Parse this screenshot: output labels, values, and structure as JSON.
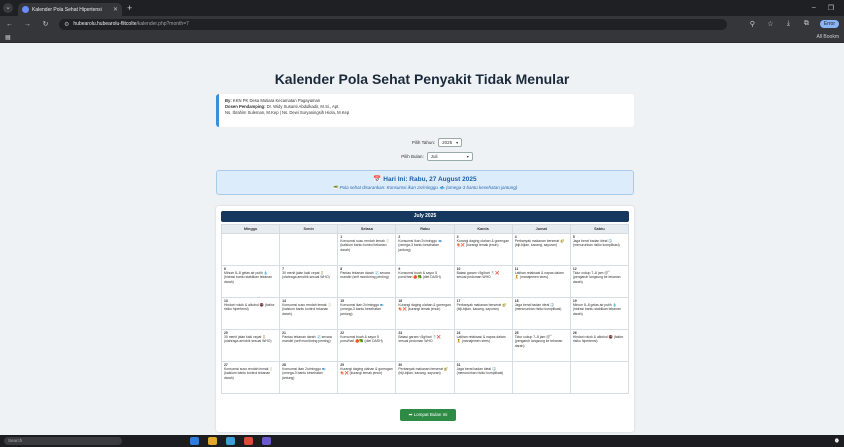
{
  "browser": {
    "tab_title": "Kalender Pola Sehat Hipertensi",
    "url_host": "hubearolu.hubearolu-flitcolte",
    "url_path": "/kalender.php?month=7",
    "all_bookmarks": "All Bookm",
    "profile_label": "Error"
  },
  "page": {
    "title": "Kalender Pola Sehat Penyakit Tidak Menular",
    "info": {
      "line1_label": "By:",
      "line1": "KKN PK Desa Mutiara Kecamatan Pagayaman",
      "line2_label": "Dosen Pendamping:",
      "line2": "Dr. Widy Susanti Abdulkadir, M.Si., Apt.",
      "line3": "Ns. Ibrahim Suleman, M.Kep | Ns. Dewi Suryaningsih Hiola, M.Kep"
    },
    "year_label": "Pilih Tahun:",
    "year_value": "2025",
    "month_label": "Pilih Bulan:",
    "month_value": "Juli",
    "today_title": "📅 Hari Ini: Rabu, 27 August 2025",
    "today_sub": "🥗 Pola sehat disarankan: Konsumsi ikan 2x/minggu 🐟 (omega-3 bantu kesehatan jantung)",
    "calendar_title": "July 2025",
    "weekdays": [
      "Minggu",
      "Senin",
      "Selasa",
      "Rabu",
      "Kamis",
      "Jumat",
      "Sabtu"
    ],
    "weeks": [
      [
        {
          "d": "",
          "t": ""
        },
        {
          "d": "",
          "t": ""
        },
        {
          "d": "1",
          "t": "Konsumsi susu rendah lemak 🥛 (kalsium bantu kontrol tekanan darah)"
        },
        {
          "d": "2",
          "t": "Konsumsi ikan 2x/minggu 🐟 (omega-3 bantu kesehatan jantung)"
        },
        {
          "d": "3",
          "t": "Kurangi daging olahan & gorengan 🍖❌ (kurangi lemak jenuh)"
        },
        {
          "d": "4",
          "t": "Perbanyak makanan berserat 🥑 (biji-bijian, kacang, sayuran)"
        },
        {
          "d": "5",
          "t": "Jaga berat badan ideal ⚖️ (menurunkan risiko komplikasi)"
        }
      ],
      [
        {
          "d": "6",
          "t": "Minum 8–8 gelas air putih 💧 (hidrasi bantu stabilkan tekanan darah)"
        },
        {
          "d": "7",
          "t": "30 menit jalan kaki cepat 🚶 (olahraga aerobik sesuai WHO)"
        },
        {
          "d": "8",
          "t": "Pantau tekanan darah 🩺 secara mandiri (self monitoring penting)"
        },
        {
          "d": "9",
          "t": "Konsumsi buah & sayur 5 porsi/hari 🍎🥦 (diet DASH)"
        },
        {
          "d": "10",
          "t": "Batasi garam <5g/hari 🧂❌ sesuai pedoman WHO"
        },
        {
          "d": "11",
          "t": "Latihan relaksasi & napas dalam 🧘 (manajemen stres)"
        },
        {
          "d": "12",
          "t": "Tidur cukup 7–8 jam 😴 (pengaruh langsung ke tekanan darah)"
        }
      ],
      [
        {
          "d": "13",
          "t": "Hindari rokok & alkohol 🚭 (faktor risiko hipertensi)"
        },
        {
          "d": "14",
          "t": "Konsumsi susu rendah lemak 🥛 (kalsium bantu kontrol tekanan darah)"
        },
        {
          "d": "15",
          "t": "Konsumsi ikan 2x/minggu 🐟 (omega-3 bantu kesehatan jantung)"
        },
        {
          "d": "16",
          "t": "Kurangi daging olahan & gorengan 🍖❌ (kurangi lemak jenuh)"
        },
        {
          "d": "17",
          "t": "Perbanyak makanan berserat 🥑 (biji-bijian, kacang, sayuran)"
        },
        {
          "d": "18",
          "t": "Jaga berat badan ideal ⚖️ (menurunkan risiko komplikasi)"
        },
        {
          "d": "19",
          "t": "Minum 8–8 gelas air putih 💧 (hidrasi bantu stabilkan tekanan darah)"
        }
      ],
      [
        {
          "d": "20",
          "t": "30 menit jalan kaki cepat 🚶 (olahraga aerobik sesuai WHO)"
        },
        {
          "d": "21",
          "t": "Pantau tekanan darah 🩺 secara mandiri (self monitoring penting)"
        },
        {
          "d": "22",
          "t": "Konsumsi buah & sayur 5 porsi/hari 🍎🥦 (diet DASH)"
        },
        {
          "d": "23",
          "t": "Batasi garam <5g/hari 🧂❌ sesuai pedoman WHO"
        },
        {
          "d": "24",
          "t": "Latihan relaksasi & napas dalam 🧘 (manajemen stres)"
        },
        {
          "d": "25",
          "t": "Tidur cukup 7–8 jam 😴 (pengaruh langsung ke tekanan darah)"
        },
        {
          "d": "26",
          "t": "Hindari rokok & alkohol 🚭 (faktor risiko hipertensi)"
        }
      ],
      [
        {
          "d": "27",
          "t": "Konsumsi susu rendah lemak 🥛 (kalsium bantu kontrol tekanan darah)"
        },
        {
          "d": "28",
          "t": "Konsumsi ikan 2x/minggu 🐟 (omega-3 bantu kesehatan jantung)"
        },
        {
          "d": "29",
          "t": "Kurangi daging olahan & gorengan 🍖❌ (kurangi lemak jenuh)"
        },
        {
          "d": "30",
          "t": "Perbanyak makanan berserat 🥑 (biji-bijian, kacang, sayuran)"
        },
        {
          "d": "31",
          "t": "Jaga berat badan ideal ⚖️ (menurunkan risiko komplikasi)"
        },
        {
          "d": "",
          "t": ""
        },
        {
          "d": "",
          "t": ""
        }
      ]
    ],
    "next_button": "➡ Lompat Bulan Ini"
  },
  "taskbar": {
    "search_placeholder": "Search"
  }
}
